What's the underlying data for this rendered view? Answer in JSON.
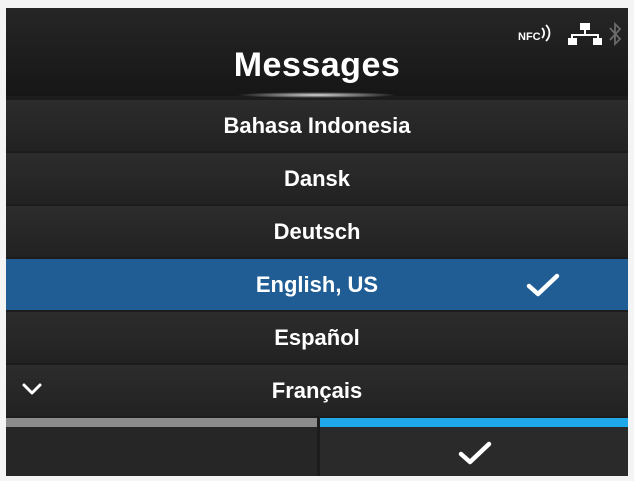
{
  "header": {
    "title": "Messages",
    "status": {
      "nfc_label": "NFC"
    }
  },
  "languages": [
    {
      "label": "Bahasa Indonesia",
      "selected": false
    },
    {
      "label": "Dansk",
      "selected": false
    },
    {
      "label": "Deutsch",
      "selected": false
    },
    {
      "label": "English, US",
      "selected": true
    },
    {
      "label": "Español",
      "selected": false
    },
    {
      "label": "Français",
      "selected": false
    }
  ],
  "icons": {
    "selected_mark": "checkmark-icon",
    "scroll_more": "chevron-down-icon",
    "confirm": "checkmark-icon",
    "network": "network-icon",
    "nfc": "nfc-icon",
    "bluetooth": "bluetooth-icon"
  },
  "colors": {
    "selected_row": "#1f5d94",
    "confirm_bar": "#1ea8e8",
    "cancel_bar": "#8c8c8c"
  }
}
